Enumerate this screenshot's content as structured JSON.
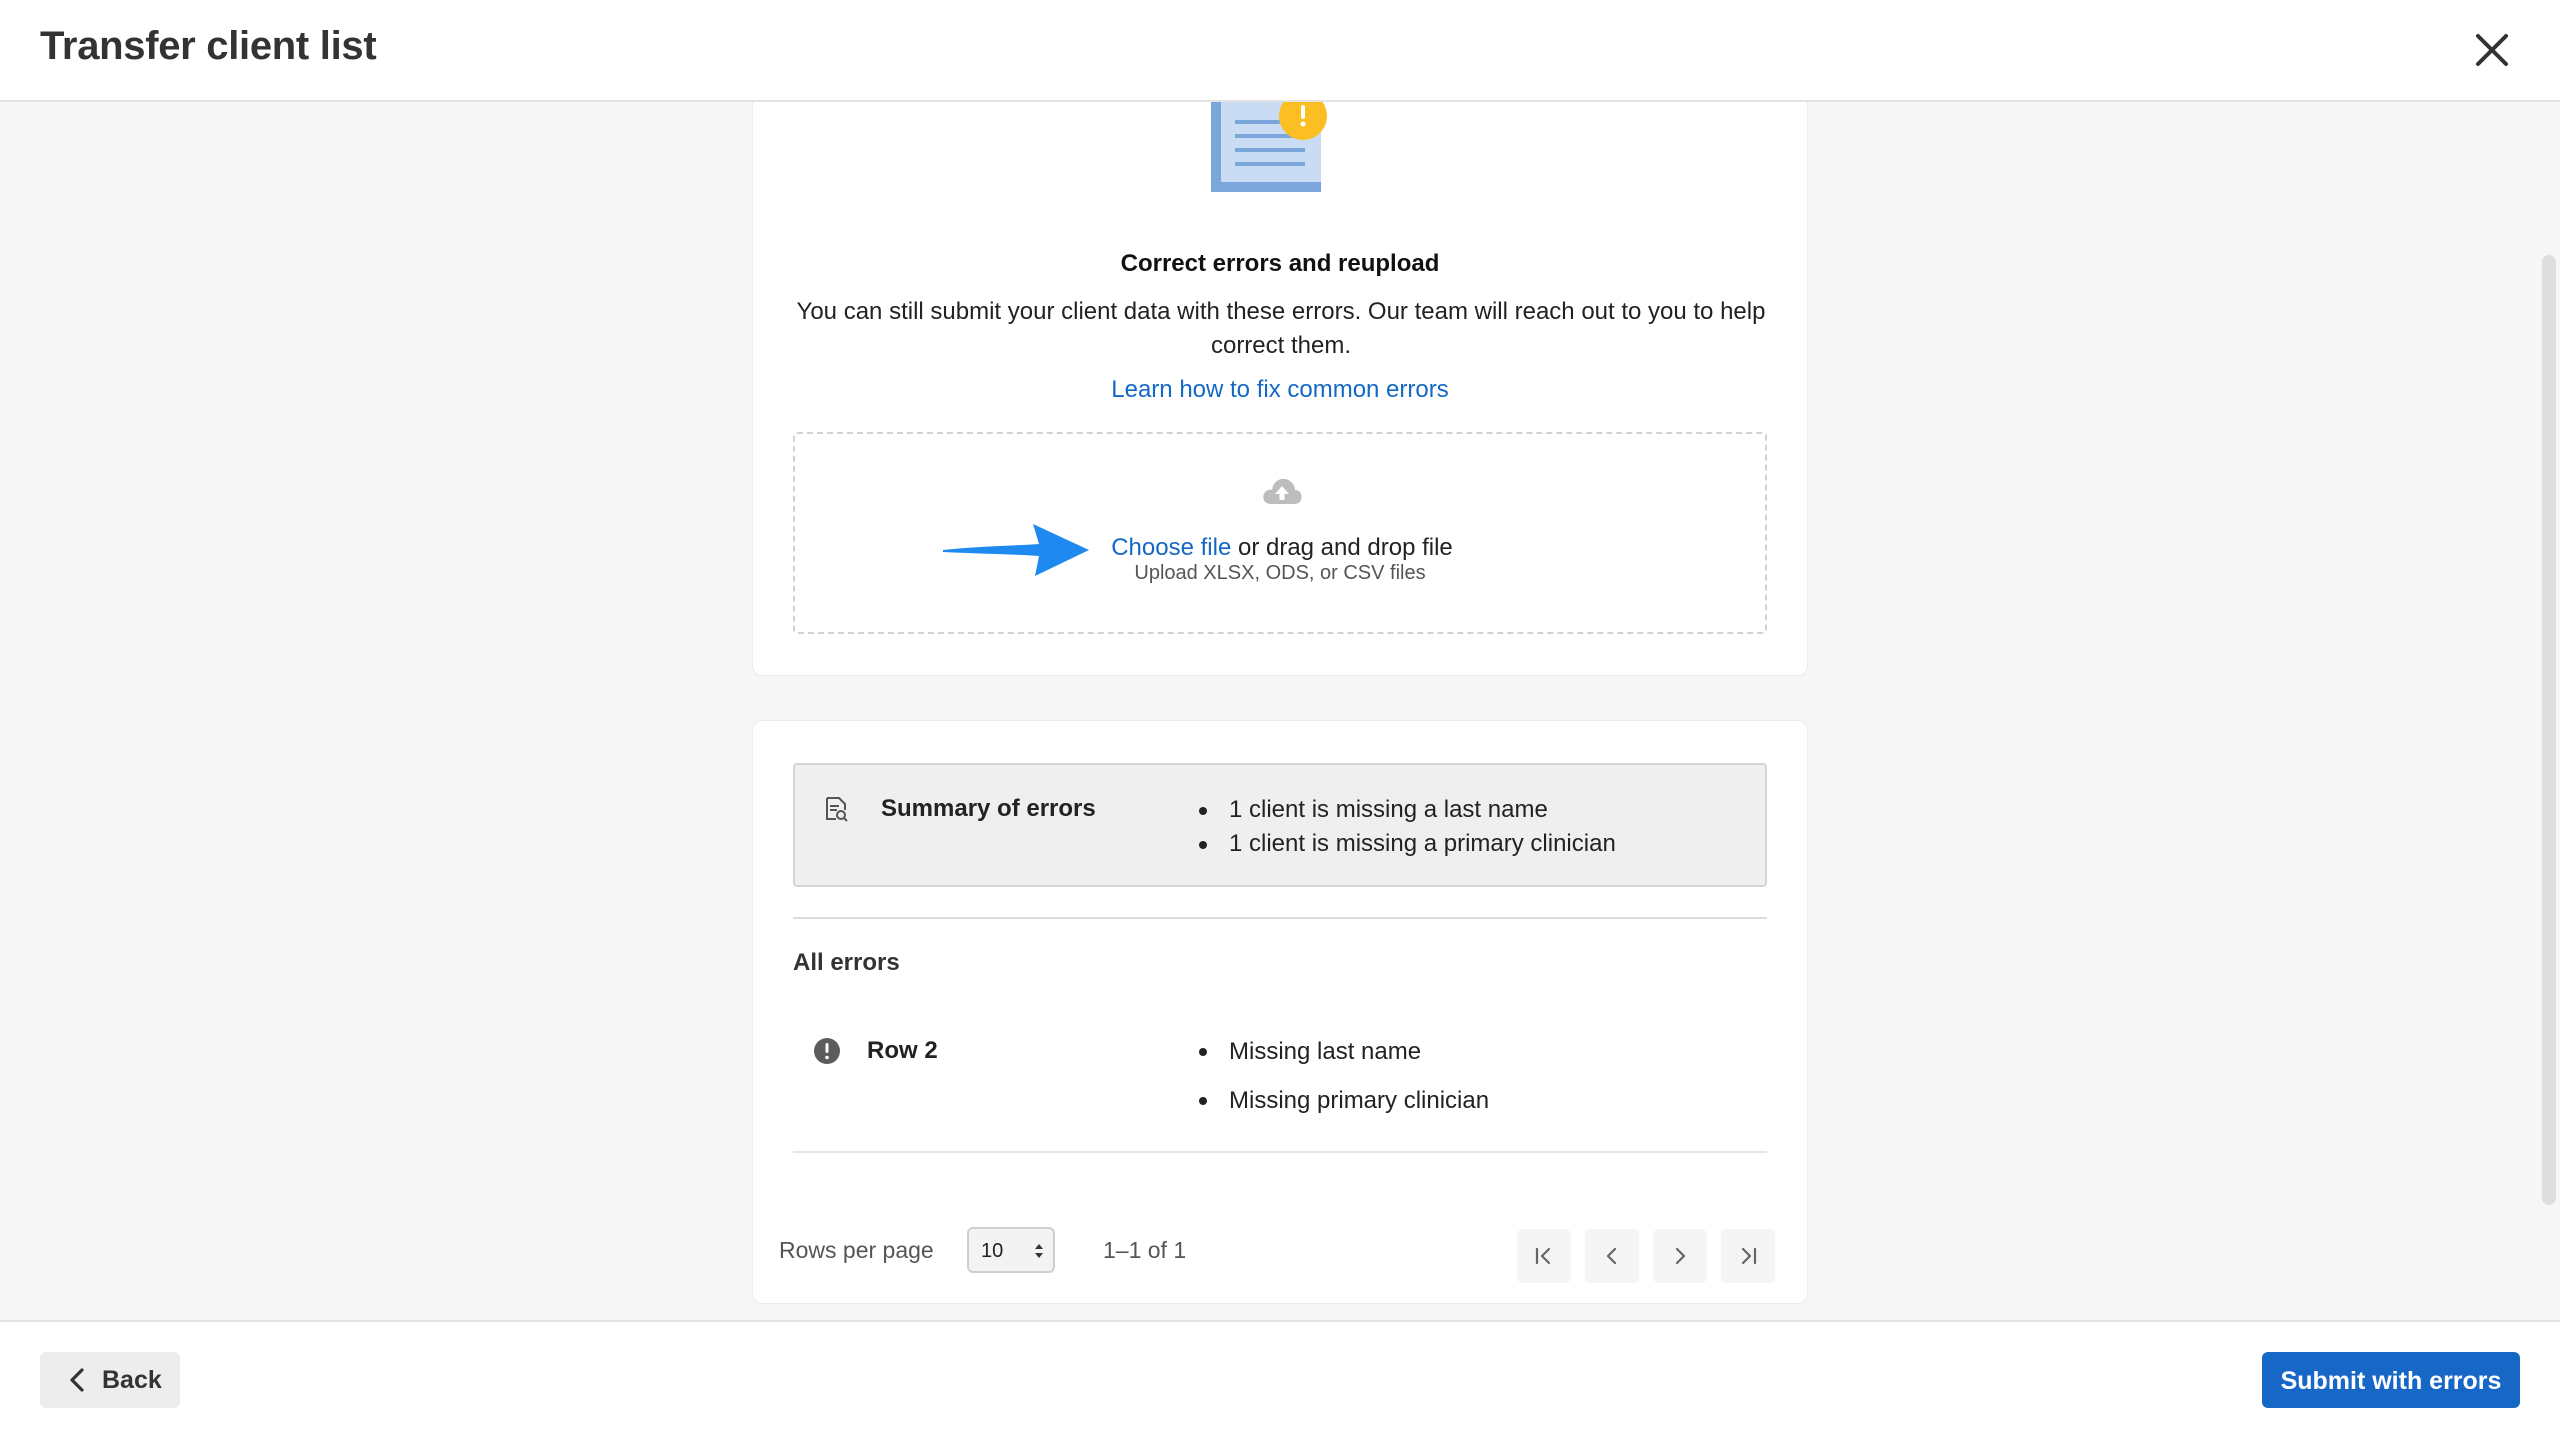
{
  "header": {
    "title": "Transfer client list"
  },
  "upload": {
    "heading": "Correct errors and reupload",
    "description": "You can still submit your client data with these errors. Our team will reach out to you to help correct them.",
    "learn_link": "Learn how to fix common errors",
    "choose_file": "Choose file",
    "drag_drop": " or drag and drop file",
    "file_types": "Upload XLSX, ODS, or CSV files"
  },
  "summary": {
    "title": "Summary of errors",
    "items": [
      "1 client is missing a last name",
      "1 client is missing a primary clinician"
    ]
  },
  "all_errors": {
    "heading": "All errors",
    "rows": [
      {
        "label": "Row 2",
        "errors": [
          "Missing last name",
          "Missing primary clinician"
        ]
      }
    ]
  },
  "pagination": {
    "rows_per_page_label": "Rows per page",
    "rows_per_page_value": "10",
    "range": "1–1 of 1"
  },
  "footer": {
    "back_label": "Back",
    "submit_label": "Submit with errors"
  },
  "colors": {
    "accent": "#1768c6",
    "link": "#1468c5",
    "warning": "#fbbf24",
    "annotation_arrow": "#1e8af0"
  }
}
